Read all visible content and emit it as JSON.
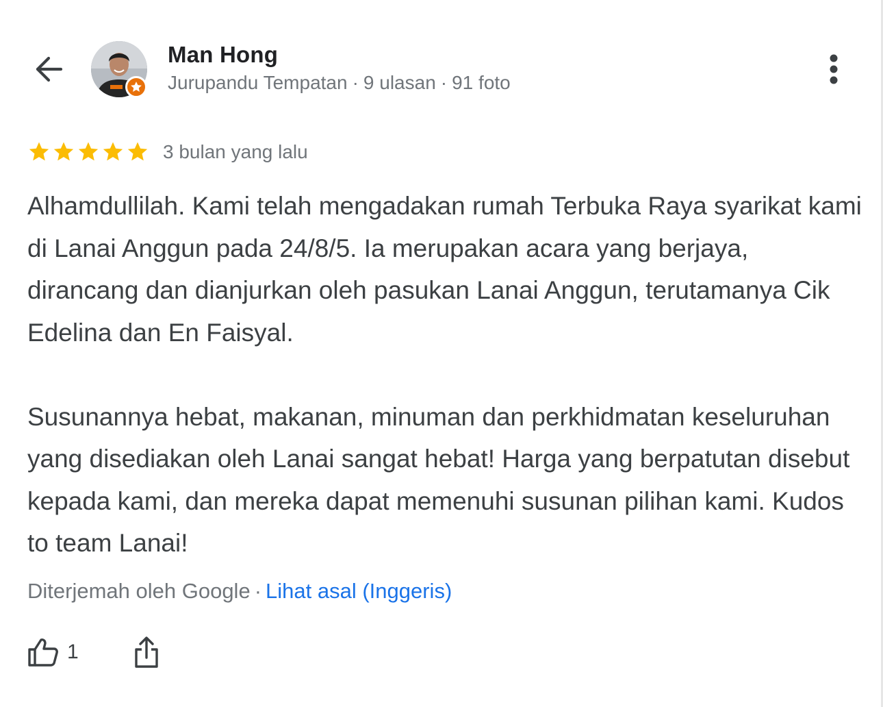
{
  "header": {
    "back_icon": "arrow-back-icon",
    "reviewer_name": "Man Hong",
    "reviewer_title": "Jurupandu Tempatan",
    "separator": "·",
    "review_count": "9 ulasan",
    "photo_count": "91 foto",
    "badge_icon": "local-guide-star-icon",
    "more_icon": "more-vert-icon"
  },
  "rating": {
    "stars": 5,
    "max_stars": 5,
    "star_color": "#fbbc04",
    "time": "3 bulan yang lalu"
  },
  "review": {
    "paragraphs": [
      "Alhamdullilah. Kami telah mengadakan rumah Terbuka Raya syarikat kami di Lanai Anggun pada 24/8/5. Ia merupakan acara yang berjaya, dirancang dan dianjurkan oleh pasukan Lanai Anggun, terutamanya Cik Edelina dan En Faisyal.",
      "Susunannya hebat, makanan, minuman dan perkhidmatan keseluruhan yang disediakan oleh Lanai sangat hebat! Harga yang berpatutan disebut kepada kami, dan mereka dapat memenuhi susunan pilihan kami. Kudos to team Lanai!"
    ]
  },
  "translation": {
    "note": "Diterjemah oleh Google",
    "separator": "·",
    "link": "Lihat asal (Inggeris)",
    "link_color": "#1a73e8"
  },
  "actions": {
    "like_icon": "thumb-up-icon",
    "like_count": "1",
    "share_icon": "share-icon"
  }
}
